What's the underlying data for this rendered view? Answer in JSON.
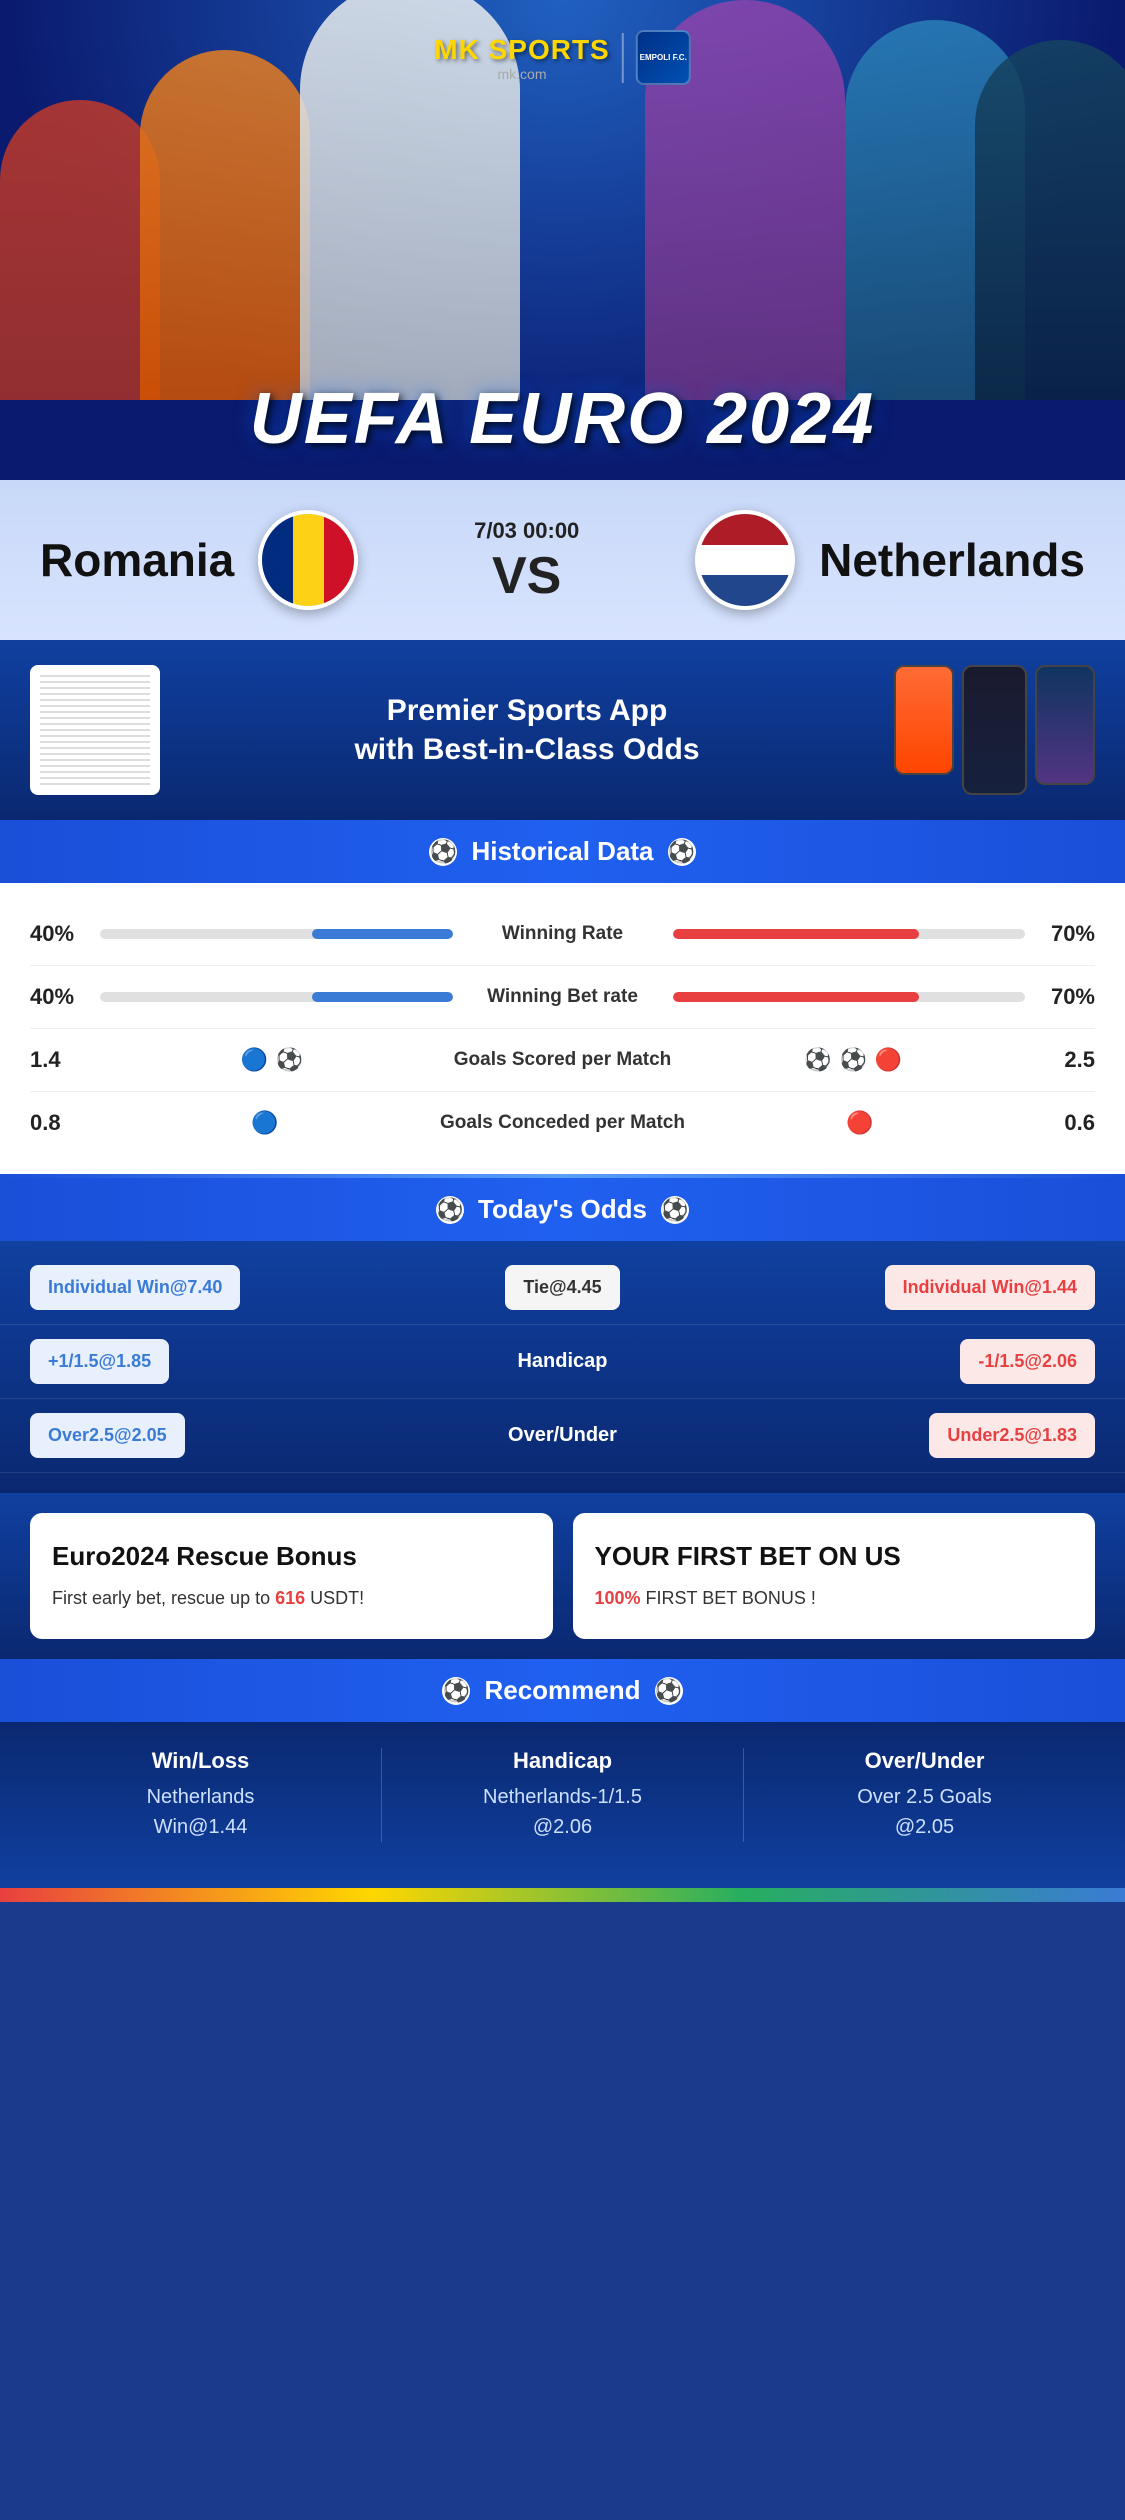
{
  "brand": {
    "name": "MK",
    "sub": "SPORTS",
    "domain": "mk.com",
    "badge": "EMPOLI F.C."
  },
  "hero": {
    "title": "UEFA EURO 2024"
  },
  "match": {
    "team_home": "Romania",
    "team_away": "Netherlands",
    "datetime": "7/03 00:00",
    "vs": "VS"
  },
  "promo": {
    "text": "Premier Sports App\nwith Best-in-Class Odds"
  },
  "historical": {
    "header": "Historical Data",
    "stats": [
      {
        "label": "Winning Rate",
        "left_val": "40%",
        "right_val": "70%",
        "left_pct": 40,
        "right_pct": 70
      },
      {
        "label": "Winning Bet rate",
        "left_val": "40%",
        "right_val": "70%",
        "left_pct": 40,
        "right_pct": 70
      },
      {
        "label": "Goals Scored per Match",
        "left_val": "1.4",
        "right_val": "2.5",
        "type": "goals"
      },
      {
        "label": "Goals Conceded per Match",
        "left_val": "0.8",
        "right_val": "0.6",
        "type": "conceded"
      }
    ]
  },
  "odds": {
    "header": "Today's Odds",
    "rows": [
      {
        "left": "Individual Win@7.40",
        "center": "Tie@4.45",
        "right": "Individual Win@1.44",
        "left_type": "blue",
        "right_type": "red"
      },
      {
        "left": "+1/1.5@1.85",
        "center": "Handicap",
        "right": "-1/1.5@2.06",
        "left_type": "blue",
        "right_type": "red"
      },
      {
        "left": "Over2.5@2.05",
        "center": "Over/Under",
        "right": "Under2.5@1.83",
        "left_type": "blue",
        "right_type": "red"
      }
    ]
  },
  "bonus": {
    "card1": {
      "title": "Euro2024 Rescue Bonus",
      "text": "First early bet, rescue up to ",
      "highlight": "616",
      "suffix": " USDT!"
    },
    "card2": {
      "title": "YOUR FIRST BET ON US",
      "text": "",
      "highlight": "100%",
      "suffix": " FIRST BET BONUS !"
    }
  },
  "recommend": {
    "header": "Recommend",
    "cols": [
      {
        "label": "Win/Loss",
        "line1": "Netherlands",
        "line2": "Win@1.44"
      },
      {
        "label": "Handicap",
        "line1": "Netherlands-1/1.5",
        "line2": "@2.06"
      },
      {
        "label": "Over/Under",
        "line1": "Over 2.5 Goals",
        "line2": "@2.05"
      }
    ]
  }
}
